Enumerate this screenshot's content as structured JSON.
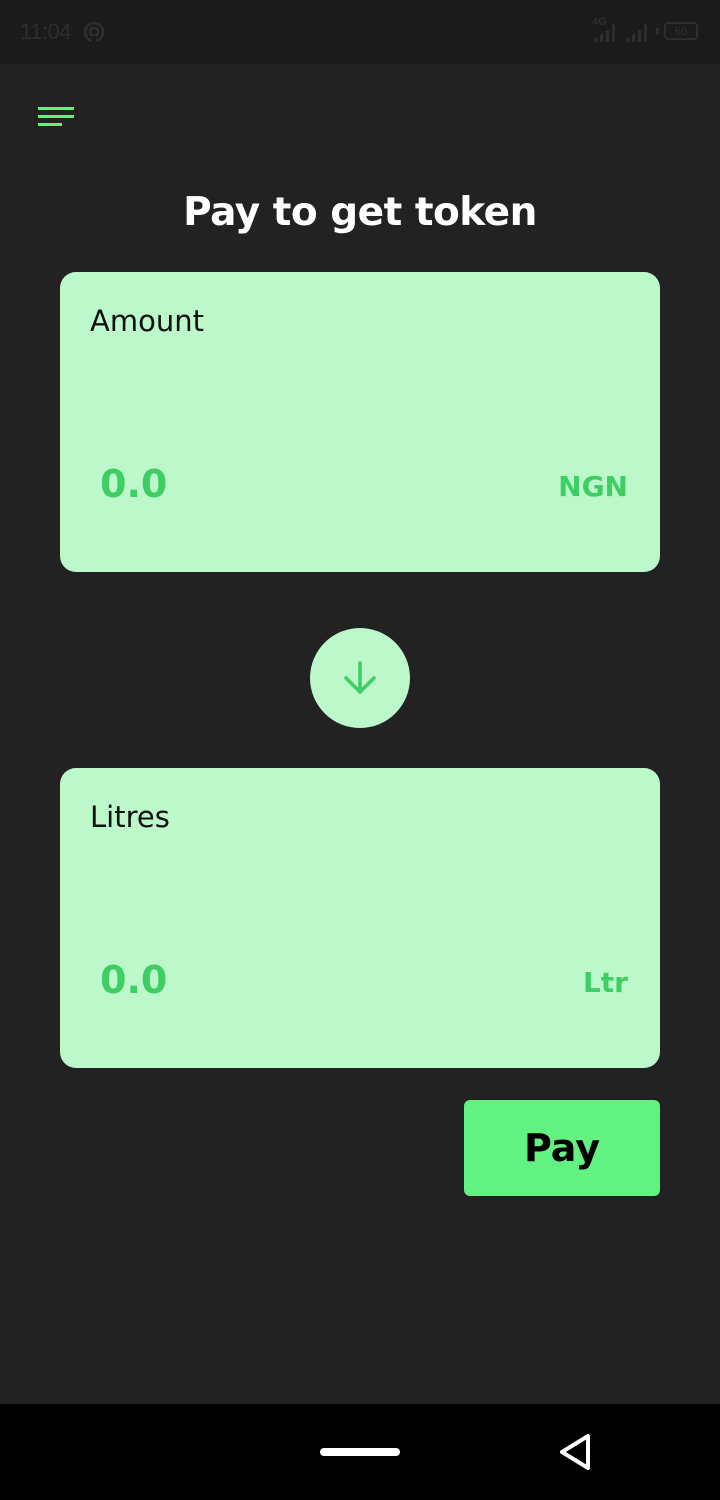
{
  "status_bar": {
    "time": "11:04",
    "network": "4G",
    "battery": "66",
    "icons": [
      "hotspot-icon",
      "signal-icon",
      "battery-icon"
    ]
  },
  "header": {
    "menu_icon": "hamburger-menu-icon",
    "title": "Pay to get token"
  },
  "amount_card": {
    "label": "Amount",
    "value": "0.0",
    "unit": "NGN"
  },
  "swap": {
    "icon": "arrow-down-icon"
  },
  "litres_card": {
    "label": "Litres",
    "value": "0.0",
    "unit": "Ltr"
  },
  "pay_button": {
    "label": "Pay"
  },
  "nav_bar": {
    "icons": [
      "home-pill-icon",
      "back-triangle-icon"
    ]
  },
  "colors": {
    "background": "#222222",
    "card": "#bdf8cb",
    "accent_text": "#3ece63",
    "button": "#62f282"
  }
}
